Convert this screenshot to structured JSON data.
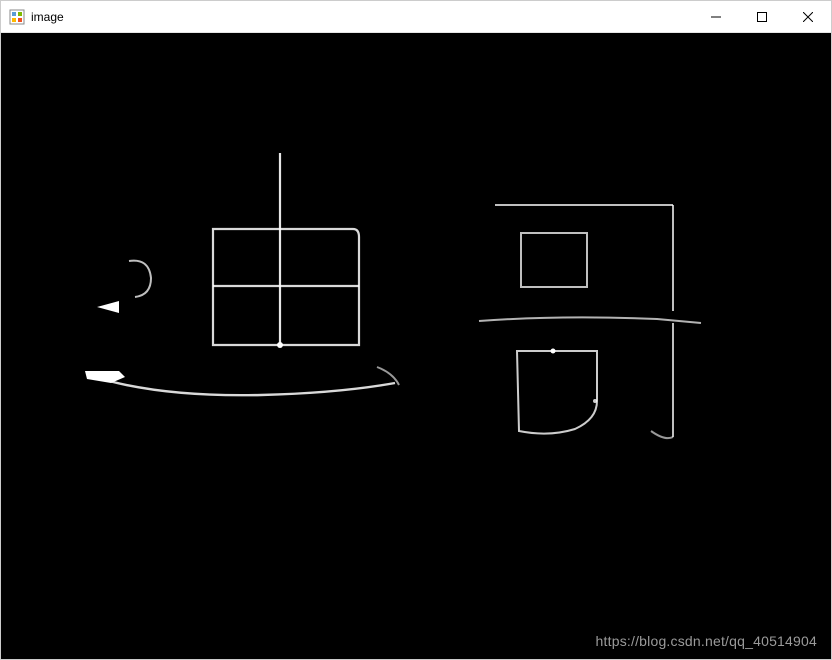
{
  "window": {
    "title": "image",
    "icon_name": "app-icon"
  },
  "controls": {
    "minimize": "minimize",
    "maximize": "maximize",
    "close": "close"
  },
  "content": {
    "background_color": "#000000",
    "stroke_color": "#ffffff",
    "description": "Edge-detected image showing handwritten Chinese characters '迪哥' in white strokes on black background",
    "watermark": "https://blog.csdn.net/qq_40514904"
  }
}
